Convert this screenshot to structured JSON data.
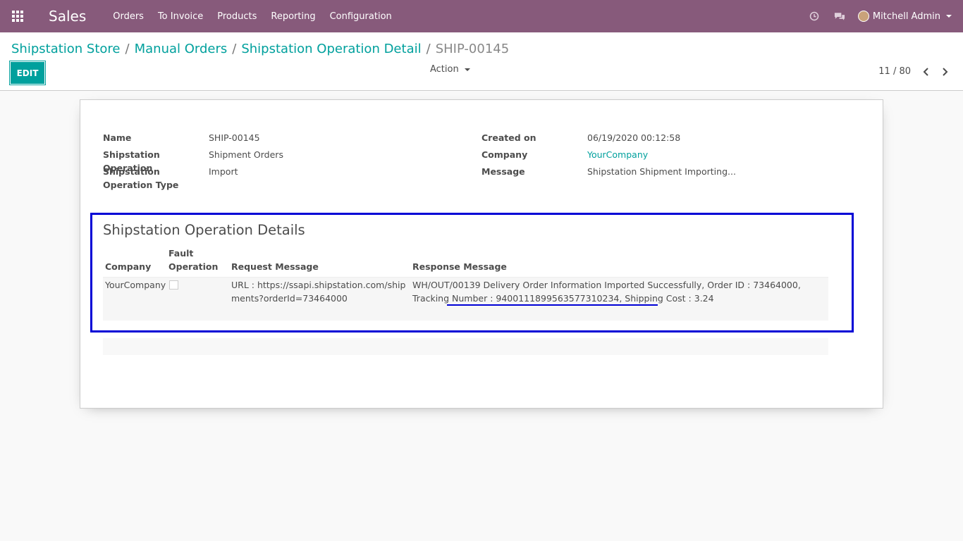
{
  "navbar": {
    "brand": "Sales",
    "menu": [
      "Orders",
      "To Invoice",
      "Products",
      "Reporting",
      "Configuration"
    ],
    "user": "Mitchell Admin"
  },
  "breadcrumb": {
    "items": [
      "Shipstation Store",
      "Manual Orders",
      "Shipstation Operation Detail"
    ],
    "current": "SHIP-00145"
  },
  "toolbar": {
    "edit_label": "EDIT",
    "action_label": "Action",
    "pager": "11 / 80"
  },
  "form": {
    "name_label": "Name",
    "name_value": "SHIP-00145",
    "operation_label": "Shipstation Operation",
    "operation_value": "Shipment Orders",
    "operation_type_label": "Shipstation Operation Type",
    "operation_type_value": "Import",
    "created_label": "Created on",
    "created_value": "06/19/2020 00:12:58",
    "company_label": "Company",
    "company_value": "YourCompany",
    "message_label": "Message",
    "message_value": "Shipstation Shipment Importing..."
  },
  "details": {
    "title": "Shipstation Operation Details",
    "columns": [
      "Company",
      "Fault Operation",
      "Request Message",
      "Response Message"
    ],
    "rows": [
      {
        "company": "YourCompany",
        "fault": false,
        "request": "URL : https://ssapi.shipstation.com/shipments?orderId=73464000",
        "response": "WH/OUT/00139 Delivery Order Information Imported Successfully, Order ID : 73464000, Tracking Number : 9400111899563577310234, Shipping Cost : 3.24"
      }
    ]
  },
  "colors": {
    "navbar": "#875a7b",
    "accent": "#00a09d",
    "highlight": "#0000d6"
  }
}
